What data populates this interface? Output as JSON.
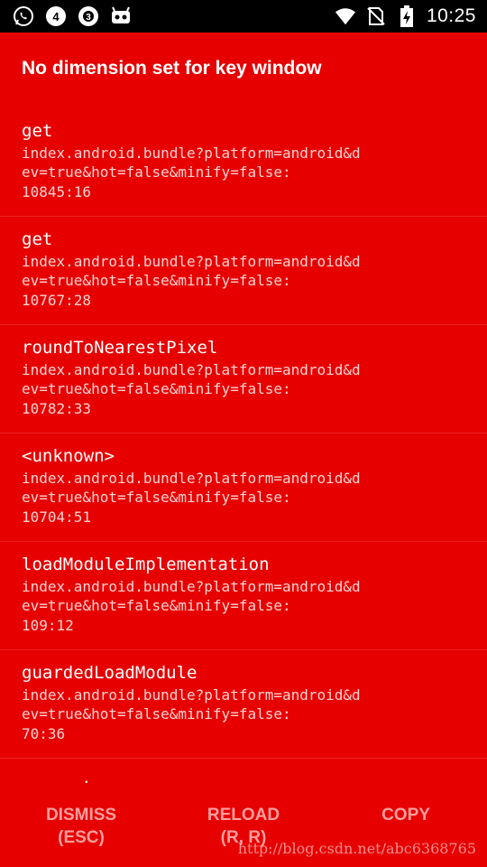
{
  "status_bar": {
    "time": "10:25",
    "left_icons": [
      "whatsapp-icon",
      "notification-4-icon",
      "notification-3-icon",
      "android-bot-icon"
    ],
    "right_icons": [
      "wifi-icon",
      "no-sim-icon",
      "battery-charging-icon"
    ],
    "badges": {
      "notif4": "4",
      "notif3": "3"
    }
  },
  "error": {
    "title": "No dimension set for key window"
  },
  "stack": [
    {
      "fn": "get",
      "loc": "index.android.bundle?platform=android&dev=true&hot=false&minify=false:",
      "line": "10845:16"
    },
    {
      "fn": "get",
      "loc": "index.android.bundle?platform=android&dev=true&hot=false&minify=false:",
      "line": "10767:28"
    },
    {
      "fn": "roundToNearestPixel",
      "loc": "index.android.bundle?platform=android&dev=true&hot=false&minify=false:",
      "line": "10782:33"
    },
    {
      "fn": "<unknown>",
      "loc": "index.android.bundle?platform=android&dev=true&hot=false&minify=false:",
      "line": "10704:51"
    },
    {
      "fn": "loadModuleImplementation",
      "loc": "index.android.bundle?platform=android&dev=true&hot=false&minify=false:",
      "line": "109:12"
    },
    {
      "fn": "guardedLoadModule",
      "loc": "index.android.bundle?platform=android&dev=true&hot=false&minify=false:",
      "line": "70:36"
    }
  ],
  "partial_text": ".",
  "buttons": {
    "dismiss": {
      "line1": "DISMISS",
      "line2": "(ESC)"
    },
    "reload": {
      "line1": "RELOAD",
      "line2": "(R, R)"
    },
    "copy": {
      "line1": "COPY"
    }
  },
  "watermark": "http://blog.csdn.net/abc6368765",
  "colors": {
    "background": "#e60000",
    "status_bar": "#000000",
    "button_text": "#ff9e9e",
    "location_text": "#ffd3d3"
  }
}
